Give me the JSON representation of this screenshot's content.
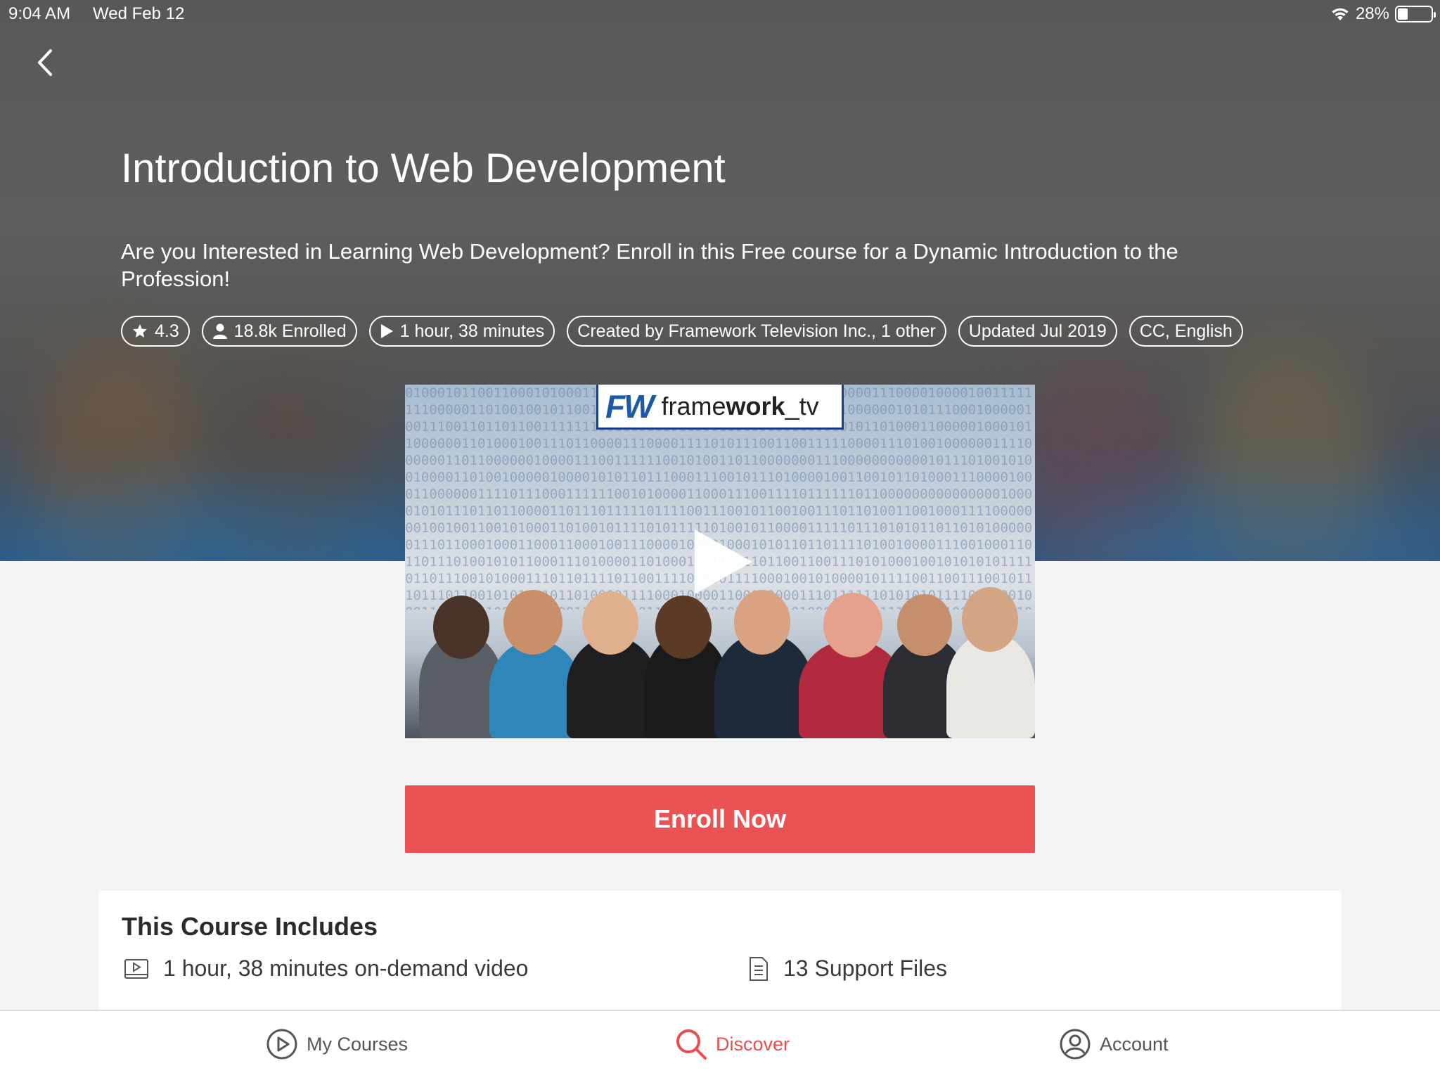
{
  "status": {
    "time": "9:04 AM",
    "date": "Wed Feb 12",
    "battery": "28%"
  },
  "course": {
    "title": "Introduction to Web Development",
    "description": "Are you Interested in Learning Web Development? Enroll in this Free course for a Dynamic Introduction to the Profession!",
    "chips": {
      "rating": "4.3",
      "enrolled": "18.8k Enrolled",
      "duration": "1 hour, 38 minutes",
      "creator": "Created by Framework Television Inc., 1 other",
      "updated": "Updated Jul 2019",
      "captions": "CC, English"
    },
    "video_logo": {
      "mark": "FW",
      "text_regular": "frame",
      "text_bold": "work",
      "text_suffix": "_tv"
    }
  },
  "actions": {
    "enroll_label": "Enroll Now"
  },
  "includes": {
    "heading": "This Course Includes",
    "items": [
      {
        "icon": "video-icon",
        "label": "1 hour, 38 minutes on-demand video"
      },
      {
        "icon": "document-icon",
        "label": "13 Support Files"
      }
    ]
  },
  "tabbar": {
    "tabs": [
      {
        "icon": "play-circle-icon",
        "label": "My Courses",
        "active": false
      },
      {
        "icon": "search-icon",
        "label": "Discover",
        "active": true
      },
      {
        "icon": "account-icon",
        "label": "Account",
        "active": false
      }
    ]
  },
  "colors": {
    "accent": "#eb5253",
    "active_tab": "#e94e4f"
  }
}
